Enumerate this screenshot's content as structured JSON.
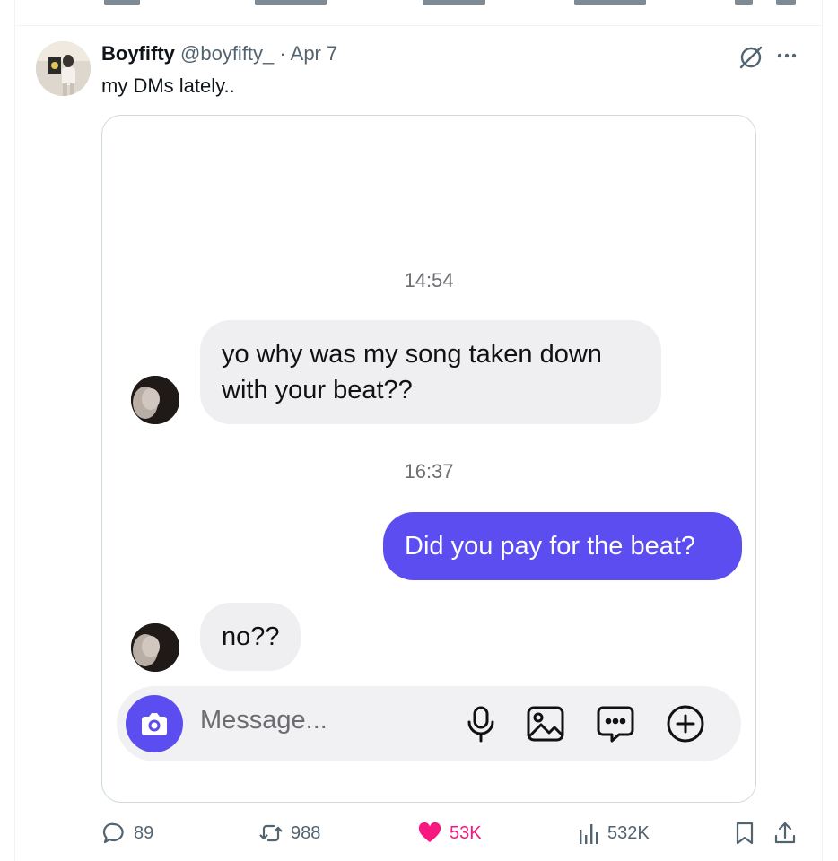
{
  "previous_tweet": {
    "cut_off": true
  },
  "tweet": {
    "author_name": "Boyfifty",
    "author_handle": "@boyfifty_",
    "separator": "·",
    "date": "Apr 7",
    "text": "my DMs lately..",
    "icons": [
      "grok-icon",
      "more-options-icon"
    ]
  },
  "dm_screenshot": {
    "messages": [
      {
        "type": "timestamp",
        "text": "14:54"
      },
      {
        "type": "incoming",
        "lines": [
          "yo why was my song taken down",
          "with your beat??"
        ]
      },
      {
        "type": "timestamp",
        "text": "16:37"
      },
      {
        "type": "outgoing",
        "text": "Did you pay for the beat?"
      },
      {
        "type": "incoming",
        "text": "no??"
      }
    ],
    "composer": {
      "placeholder": "Message...",
      "icons": [
        "camera-icon",
        "microphone-icon",
        "image-icon",
        "sticker-icon",
        "plus-icon"
      ]
    },
    "colors": {
      "accent": "#5b4df0",
      "incoming_bubble": "#efeff1"
    }
  },
  "actions": {
    "replies": "89",
    "reposts": "988",
    "likes": "53K",
    "views": "532K",
    "like_color": "#f91880"
  }
}
